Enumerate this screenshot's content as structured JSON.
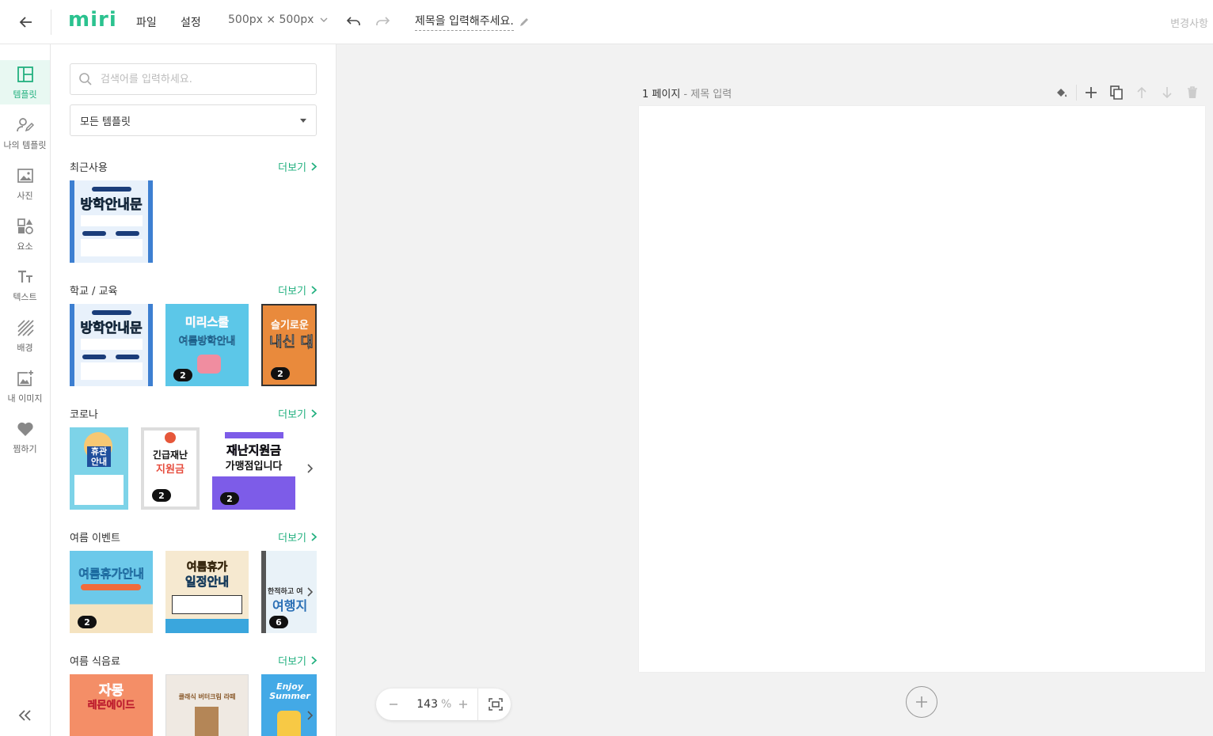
{
  "topbar": {
    "logo": "miri",
    "menu": [
      "파일",
      "설정"
    ],
    "size": "500px × 500px",
    "title": "제목을 입력해주세요.",
    "changes": "변경사항"
  },
  "rail": [
    {
      "label": "템플릿",
      "icon": "layout-icon",
      "active": true
    },
    {
      "label": "나의 템플릿",
      "icon": "user-edit-icon"
    },
    {
      "label": "사진",
      "icon": "image-icon"
    },
    {
      "label": "요소",
      "icon": "shapes-icon"
    },
    {
      "label": "텍스트",
      "icon": "text-icon"
    },
    {
      "label": "배경",
      "icon": "pattern-icon"
    },
    {
      "label": "내 이미지",
      "icon": "add-image-icon"
    },
    {
      "label": "찜하기",
      "icon": "heart-icon"
    }
  ],
  "panel": {
    "search_placeholder": "검색어를 입력하세요.",
    "filter": "모든 템플릿",
    "more_label": "더보기",
    "sections": [
      {
        "title": "최근사용"
      },
      {
        "title": "학교 / 교육"
      },
      {
        "title": "코로나"
      },
      {
        "title": "여름 이벤트"
      },
      {
        "title": "여름 식음료"
      }
    ],
    "thumb_texts": {
      "t_recent_1": "방학안내문",
      "t_school_1": "방학안내문",
      "t_school_2": "미리스쿨",
      "t_school_2b": "여름방학안내",
      "t_school_3": "슬기로운",
      "t_school_3b": "내신 대",
      "t_corona_1": "휴관 안내",
      "t_corona_2": "긴급재난",
      "t_corona_2b": "지원금",
      "t_corona_3": "재난지원금",
      "t_corona_3b": "가맹점입니다",
      "t_summer_1": "여름휴가안내",
      "t_summer_2": "여름휴가",
      "t_summer_2b": "일정안내",
      "t_summer_3": "한적하고 여",
      "t_summer_3b": "여행지",
      "t_food_1": "자몽",
      "t_food_1b": "레몬에이드",
      "t_food_2": "클래식 버터크림 라떼",
      "t_food_3": "Enjoy Summer"
    },
    "badges": {
      "b1": "2",
      "b2": "2",
      "b3": "2",
      "b4": "2",
      "b5": "2",
      "b6": "6"
    }
  },
  "canvas": {
    "page_label": "1 페이지",
    "page_title_placeholder": " - 제목 입력",
    "zoom_value": "143",
    "zoom_unit": "%"
  },
  "colors": {
    "accent": "#22b07f",
    "logo": "#2bc28f",
    "canvas_bg": "#f2f2f2"
  }
}
